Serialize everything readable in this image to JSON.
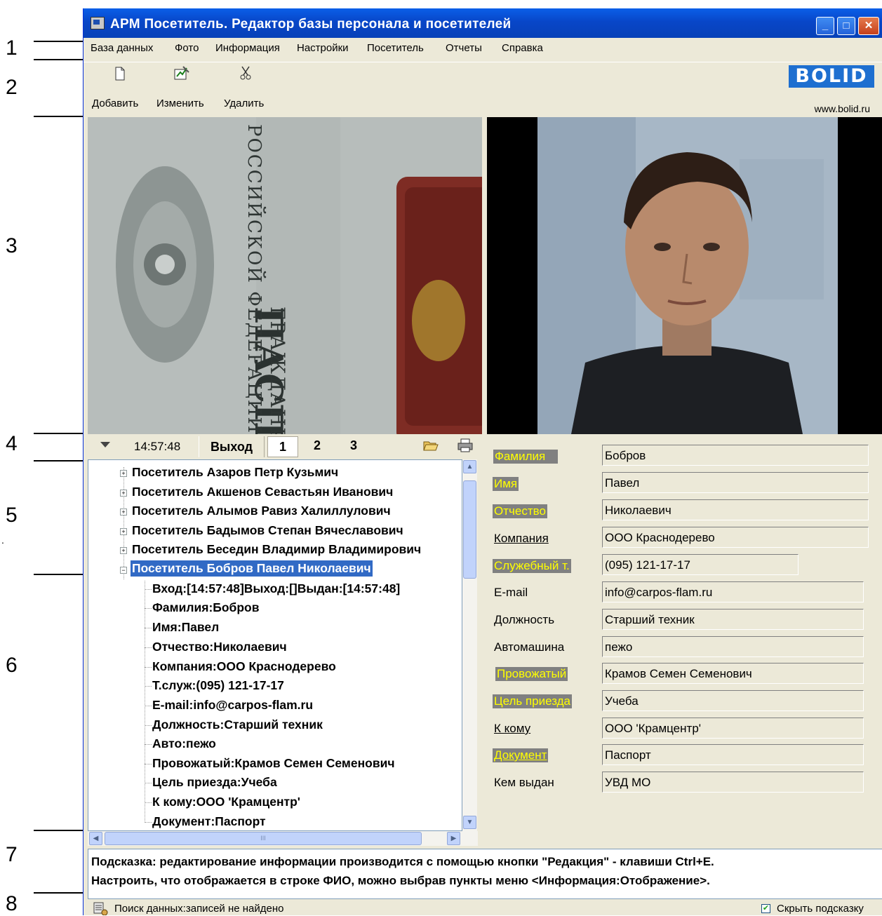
{
  "callouts": [
    "1",
    "2",
    "3",
    "4",
    "5",
    "6",
    "7",
    "8"
  ],
  "window": {
    "title": "АРМ Посетитель. Редактор базы персонала и посетителей",
    "minimize": "_",
    "maximize": "□",
    "close": "✕"
  },
  "menu": [
    "База данных",
    "Фото",
    "Информация",
    "Настройки",
    "Посетитель",
    "Отчеты",
    "Справка"
  ],
  "toolbar": {
    "add_label": "Добавить",
    "edit_label": "Изменить",
    "delete_label": "Удалить",
    "brand": "BOLID",
    "brand_url": "www.bolid.ru"
  },
  "passport_text": [
    "ПАСПОРТ",
    "ГРАЖДАНИНА",
    "РОССИЙСКОЙ ФЕДЕРАЦИИ"
  ],
  "strip": {
    "time": "14:57:48",
    "exit_label": "Выход",
    "pages": [
      "1",
      "2",
      "3"
    ],
    "open_icon": "folder-open-icon",
    "print_icon": "printer-icon"
  },
  "tree": {
    "visitors": [
      "Посетитель Азаров Петр Кузьмич",
      "Посетитель Акшенов Севастьян Иванович",
      "Посетитель Алымов Равиз Халиллулович",
      "Посетитель Бадымов Степан Вячеславович",
      "Посетитель Беседин Владимир Владимирович",
      "Посетитель Бобров Павел Николаевич"
    ],
    "details": [
      "Вход:[14:57:48]Выход:[]Выдан:[14:57:48]",
      "Фамилия:Бобров",
      "Имя:Павел",
      "Отчество:Николаевич",
      "Компания:ООО Краснодерево",
      "Т.служ:(095) 121-17-17",
      "E-mail:info@carpos-flam.ru",
      "Должность:Старший техник",
      "Авто:пежо",
      "Провожатый:Крамов Семен Семенович",
      "Цель приезда:Учеба",
      "К кому:ООО 'Крамцентр'",
      "Документ:Паспорт"
    ],
    "scroll_mark": "III"
  },
  "form": {
    "fields": [
      {
        "label": "Фамилия",
        "value": "Бобров"
      },
      {
        "label": "Имя",
        "value": "Павел"
      },
      {
        "label": "Отчество",
        "value": "Николаевич"
      },
      {
        "label": "Компания",
        "value": "ООО Краснодерево"
      },
      {
        "label": "Служебный т.",
        "value": "(095) 121-17-17"
      },
      {
        "label": "E-mail",
        "value": "info@carpos-flam.ru"
      },
      {
        "label": "Должность",
        "value": "Старший техник"
      },
      {
        "label": "Автомашина",
        "value": "пежо"
      },
      {
        "label": "Провожатый",
        "value": "Крамов Семен Семенович"
      },
      {
        "label": "Цель приезда",
        "value": "Учеба"
      },
      {
        "label": "К кому",
        "value": "ООО 'Крамцентр'"
      },
      {
        "label": "Документ",
        "value": "Паспорт"
      },
      {
        "label": "Кем выдан",
        "value": "УВД МО"
      }
    ]
  },
  "hint": {
    "line1": "Подсказка: редактирование информации производится с помощью кнопки \"Редакция\" - клавиши Ctrl+E.",
    "line2": "Настроить, что отображается в строке ФИО, можно выбрав пункты меню <Информация:Отображение>."
  },
  "status": {
    "text": "Поиск данных:записей не найдено",
    "hide_hint_label": "Скрыть подсказку",
    "hide_hint_checked": true
  }
}
